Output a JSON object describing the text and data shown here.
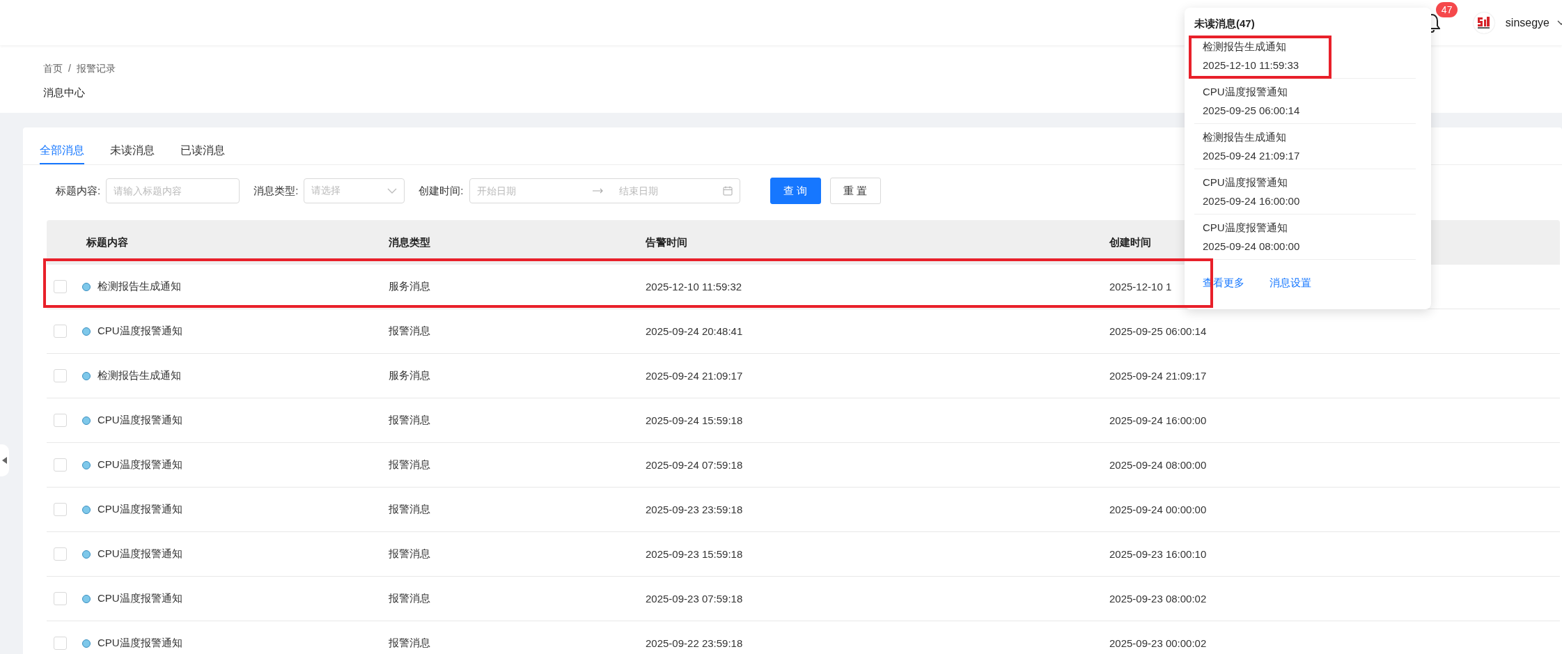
{
  "header": {
    "notification_count": "47",
    "username": "sinsegye"
  },
  "breadcrumb": {
    "items": [
      "首页",
      "报警记录"
    ],
    "separator": "/"
  },
  "page_title": "消息中心",
  "tabs": [
    {
      "label": "全部消息",
      "selected": true
    },
    {
      "label": "未读消息",
      "selected": false
    },
    {
      "label": "已读消息",
      "selected": false
    }
  ],
  "filters": [
    {
      "kind": "text",
      "label": "标题内容:",
      "placeholder": "请输入标题内容"
    },
    {
      "kind": "select",
      "label": "消息类型:",
      "placeholder": "请选择"
    },
    {
      "kind": "date_range",
      "label": "创建时间:",
      "start_placeholder": "开始日期",
      "end_placeholder": "结束日期"
    }
  ],
  "buttons": [
    {
      "label": "查 询",
      "kind": "primary"
    },
    {
      "label": "重 置",
      "kind": "default"
    }
  ],
  "table": {
    "columns": [
      "标题内容",
      "消息类型",
      "告警时间",
      "创建时间"
    ],
    "rows": [
      {
        "checked": false,
        "unread": true,
        "highlighted": true,
        "title": "检测报告生成通知",
        "type": "服务消息",
        "alarm_time": "2025-12-10 11:59:32",
        "created_time": "2025-12-10 1"
      },
      {
        "checked": false,
        "unread": true,
        "highlighted": false,
        "title": "CPU温度报警通知",
        "type": "报警消息",
        "alarm_time": "2025-09-24 20:48:41",
        "created_time": "2025-09-25 06:00:14"
      },
      {
        "checked": false,
        "unread": true,
        "highlighted": false,
        "title": "检测报告生成通知",
        "type": "服务消息",
        "alarm_time": "2025-09-24 21:09:17",
        "created_time": "2025-09-24 21:09:17"
      },
      {
        "checked": false,
        "unread": true,
        "highlighted": false,
        "title": "CPU温度报警通知",
        "type": "报警消息",
        "alarm_time": "2025-09-24 15:59:18",
        "created_time": "2025-09-24 16:00:00"
      },
      {
        "checked": false,
        "unread": true,
        "highlighted": false,
        "title": "CPU温度报警通知",
        "type": "报警消息",
        "alarm_time": "2025-09-24 07:59:18",
        "created_time": "2025-09-24 08:00:00"
      },
      {
        "checked": false,
        "unread": true,
        "highlighted": false,
        "title": "CPU温度报警通知",
        "type": "报警消息",
        "alarm_time": "2025-09-23 23:59:18",
        "created_time": "2025-09-24 00:00:00"
      },
      {
        "checked": false,
        "unread": true,
        "highlighted": false,
        "title": "CPU温度报警通知",
        "type": "报警消息",
        "alarm_time": "2025-09-23 15:59:18",
        "created_time": "2025-09-23 16:00:10"
      },
      {
        "checked": false,
        "unread": true,
        "highlighted": false,
        "title": "CPU温度报警通知",
        "type": "报警消息",
        "alarm_time": "2025-09-23 07:59:18",
        "created_time": "2025-09-23 08:00:02"
      },
      {
        "checked": false,
        "unread": true,
        "highlighted": false,
        "title": "CPU温度报警通知",
        "type": "报警消息",
        "alarm_time": "2025-09-22 23:59:18",
        "created_time": "2025-09-23 00:00:02"
      }
    ]
  },
  "popup": {
    "title": "未读消息(47)",
    "items": [
      {
        "title": "检测报告生成通知",
        "time": "2025-12-10 11:59:33",
        "highlighted": true
      },
      {
        "title": "CPU温度报警通知",
        "time": "2025-09-25 06:00:14",
        "highlighted": false
      },
      {
        "title": "检测报告生成通知",
        "time": "2025-09-24 21:09:17",
        "highlighted": false
      },
      {
        "title": "CPU温度报警通知",
        "time": "2025-09-24 16:00:00",
        "highlighted": false
      },
      {
        "title": "CPU温度报警通知",
        "time": "2025-09-24 08:00:00",
        "highlighted": false
      }
    ],
    "links": [
      "查看更多",
      "消息设置"
    ]
  }
}
